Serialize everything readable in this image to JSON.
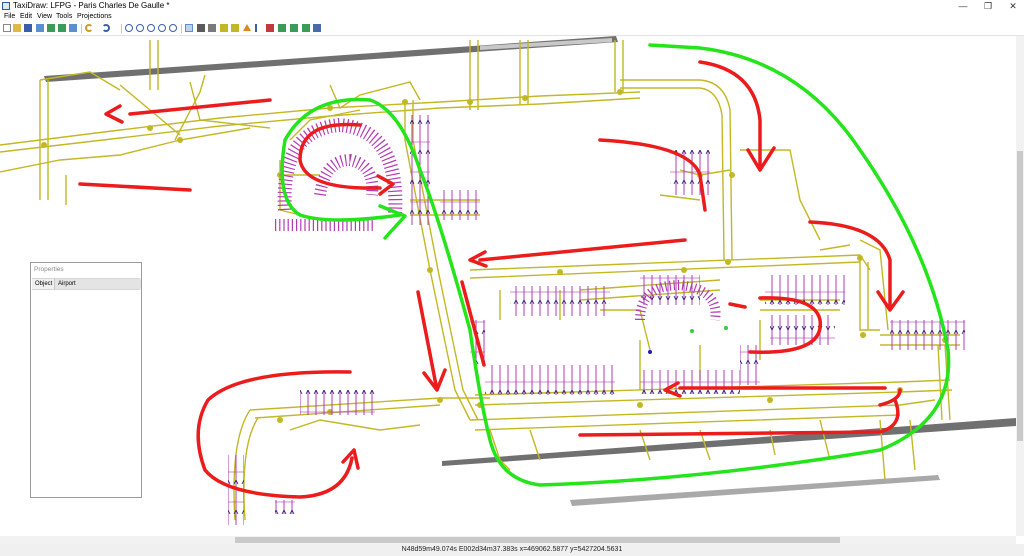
{
  "window": {
    "title": "TaxiDraw: LFPG - Paris Charles De Gaulle *",
    "controls": [
      "—",
      "❐",
      "✕"
    ]
  },
  "menu": [
    "File",
    "Edit",
    "View",
    "Tools",
    "Projections"
  ],
  "toolbar": {
    "tools": [
      "new-icon",
      "open-icon",
      "save-icon",
      "import-icon",
      "export-icon",
      "export-icon",
      "undo-icon",
      "redo-icon",
      "zoom-in-icon",
      "zoom-out-icon",
      "zoom-fit-icon",
      "zoom-window-icon",
      "refresh-icon",
      "select-icon",
      "node-icon",
      "runway-icon",
      "edit-icon",
      "taxiway-icon",
      "warning-icon",
      "arrow-icon",
      "hold-icon",
      "parking-icon",
      "taxi-route-icon",
      "light-icon",
      "sign-icon"
    ]
  },
  "properties": {
    "title": "Properties",
    "header_col1": "Object",
    "header_col2": "Airport"
  },
  "status": {
    "coords": "N48d59m49.074s E002d34m37.383s x=469062.5877 y=5427204.5631"
  },
  "colors": {
    "taxiway": "#c2b826",
    "runway": "#707070",
    "parking": "#b23bb5",
    "annotation_red": "#ec1c1c",
    "annotation_green": "#25e41c"
  }
}
